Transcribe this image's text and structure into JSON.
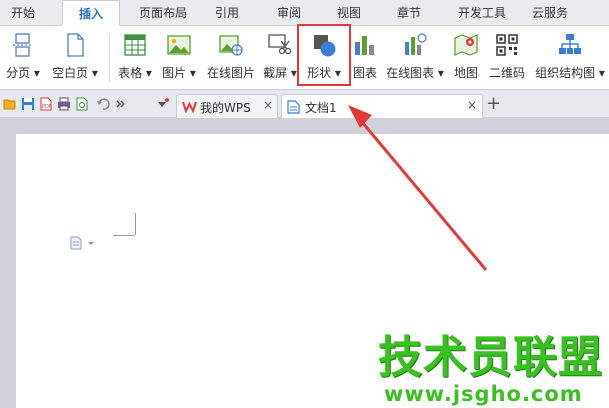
{
  "menu_tabs": [
    "开始",
    "插入",
    "页面布局",
    "引用",
    "审阅",
    "视图",
    "章节",
    "开发工具",
    "云服务"
  ],
  "active_tab": "插入",
  "ribbon": {
    "page_break": "分页",
    "blank_page": "空白页",
    "table": "表格",
    "picture": "图片",
    "online_picture": "在线图片",
    "screenshot": "截屏",
    "shape": "形状",
    "chart": "图表",
    "online_chart": "在线图表",
    "map": "地图",
    "qrcode": "二维码",
    "org_chart": "组织结构图",
    "dropdown_glyph": "▾"
  },
  "doc_tabs": {
    "my_wps": "我的WPS",
    "doc1": "文档1",
    "close_glyph": "×",
    "new_tab_glyph": "+"
  },
  "watermark": {
    "text": "技术员联盟",
    "url": "www.jsgho.com"
  },
  "colors": {
    "accent": "#2a6fc6",
    "highlight": "#e53935",
    "arrow": "#e53935",
    "watermark": "#39c021"
  }
}
